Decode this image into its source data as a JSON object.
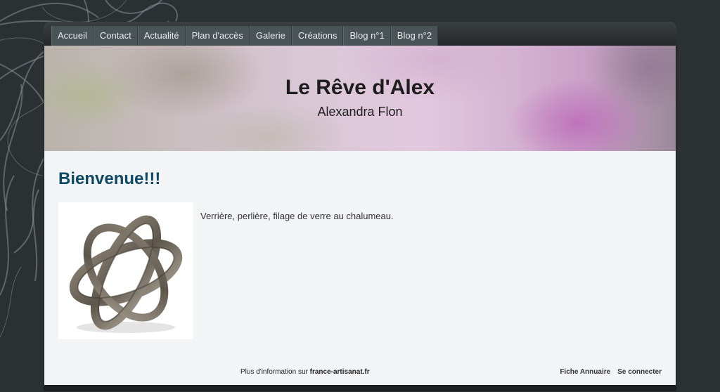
{
  "nav": {
    "items": [
      "Accueil",
      "Contact",
      "Actualité",
      "Plan d'accès",
      "Galerie",
      "Créations",
      "Blog n°1",
      "Blog n°2"
    ]
  },
  "header": {
    "title": "Le Rêve d'Alex",
    "subtitle": "Alexandra Flon"
  },
  "main": {
    "heading": "Bienvenue!!!",
    "intro": "Verrière, perlière, filage de verre au chalumeau."
  },
  "footer": {
    "info_prefix": "Plus d'information sur",
    "info_link": "france-artisanat.fr",
    "directory_link": "Fiche Annuaire",
    "login_link": "Se connecter"
  },
  "colors": {
    "page_background": "#2b3032",
    "heading": "#0e4a63",
    "content_background": "#f3f4f6"
  }
}
